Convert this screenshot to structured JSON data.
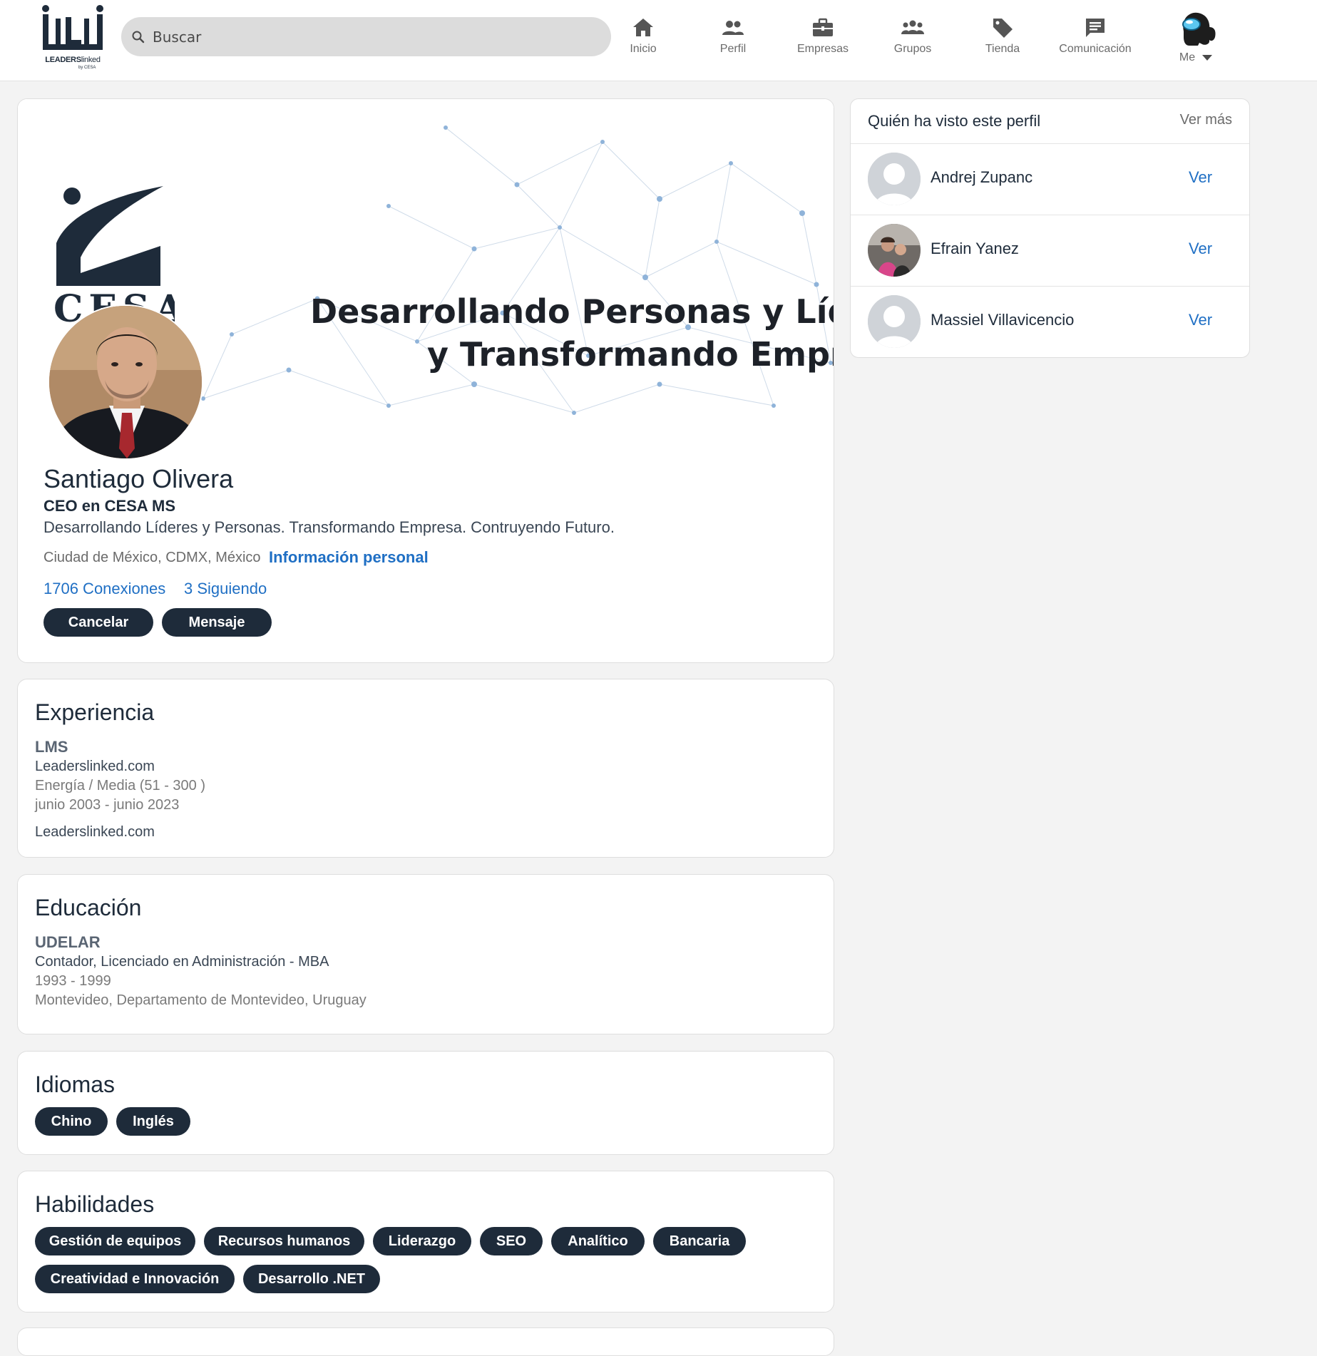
{
  "header": {
    "logo_text_bold": "LEADERS",
    "logo_text_light": "linked",
    "logo_sub": "by CESA",
    "search_placeholder": "Buscar",
    "nav": [
      {
        "label": "Inicio",
        "icon": "home-icon"
      },
      {
        "label": "Perfil",
        "icon": "people-icon"
      },
      {
        "label": "Empresas",
        "icon": "briefcase-icon"
      },
      {
        "label": "Grupos",
        "icon": "groups-icon"
      },
      {
        "label": "Tienda",
        "icon": "tag-icon"
      },
      {
        "label": "Comunicación",
        "icon": "message-icon"
      }
    ],
    "me_label": "Me"
  },
  "profile": {
    "banner_logo_text": "CESA",
    "banner_line1": "Desarrollando Personas y Líderes",
    "banner_line2": "y Transformando Empresas",
    "name": "Santiago Olivera",
    "title": "CEO en CESA MS",
    "bio": "Desarrollando Líderes y Personas. Transformando Empresa. Contruyendo Futuro.",
    "location": "Ciudad de México, CDMX, México",
    "info_link": "Información personal",
    "connections": "1706 Conexiones",
    "following": "3 Siguiendo",
    "cancel_label": "Cancelar",
    "message_label": "Mensaje"
  },
  "experience": {
    "title": "Experiencia",
    "company": "LMS",
    "website": "Leaderslinked.com",
    "industry": "Energía / Media (51 - 300 )",
    "dates": "junio 2003 - junio 2023",
    "description": "Leaderslinked.com"
  },
  "education": {
    "title": "Educación",
    "school": "UDELAR",
    "degree": "Contador, Licenciado en Administración - MBA",
    "years": "1993 - 1999",
    "location": "Montevideo, Departamento de Montevideo, Uruguay"
  },
  "languages": {
    "title": "Idiomas",
    "items": [
      "Chino",
      "Inglés"
    ]
  },
  "skills": {
    "title": "Habilidades",
    "items": [
      "Gestión de equipos",
      "Recursos humanos",
      "Liderazgo",
      "SEO",
      "Analítico",
      "Bancaria",
      "Creatividad e Innovación",
      "Desarrollo .NET"
    ]
  },
  "viewers": {
    "title": "Quién ha visto este perfil",
    "more": "Ver más",
    "items": [
      {
        "name": "Andrej Zupanc",
        "action": "Ver"
      },
      {
        "name": "Efrain Yanez",
        "action": "Ver"
      },
      {
        "name": "Massiel Villavicencio",
        "action": "Ver"
      }
    ]
  },
  "colors": {
    "navy": "#1e2b3a",
    "link_blue": "#1f6fc4",
    "background": "#f3f3f3"
  }
}
